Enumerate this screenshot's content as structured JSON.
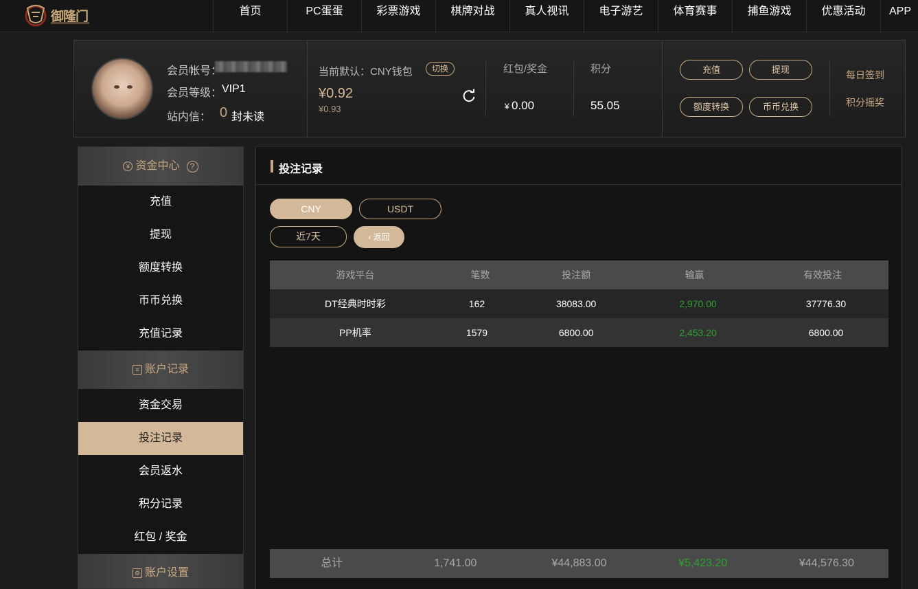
{
  "header": {
    "logo_text": "御隆门",
    "nav": [
      "首页",
      "PC蛋蛋",
      "彩票游戏",
      "棋牌对战",
      "真人视讯",
      "电子游艺",
      "体育赛事",
      "捕鱼游戏",
      "优惠活动",
      "APP"
    ]
  },
  "profile": {
    "account_label": "会员帐号：",
    "level_label": "会员等级：",
    "level_value": "VIP1",
    "inbox_label": "站内信：",
    "inbox_count": "0",
    "inbox_suffix": "封未读",
    "wallet_label": "当前默认：CNY钱包",
    "switch_label": "切换",
    "wallet_amount": "¥0.92",
    "wallet_sub": "¥0.93",
    "bonus_label": "红包/奖金",
    "bonus_currency": "¥",
    "bonus_value": "0.00",
    "points_label": "积分",
    "points_value": "55.05",
    "buttons": {
      "deposit": "充值",
      "withdraw": "提现",
      "transfer": "额度转换",
      "exchange": "币币兑换"
    },
    "daily_signin": "每日签到",
    "points_lottery": "积分摇奖"
  },
  "sidebar": {
    "fund_center": "资金中心",
    "fund_items": [
      "充值",
      "提现",
      "额度转换",
      "币币兑换",
      "充值记录"
    ],
    "account_records": "账户记录",
    "record_items": [
      "资金交易",
      "投注记录",
      "会员返水",
      "积分记录",
      "红包 / 奖金"
    ],
    "account_settings": "账户设置"
  },
  "main": {
    "title": "投注记录",
    "currency_tabs": [
      "CNY",
      "USDT"
    ],
    "period_label": "近7天",
    "back_label": "返回",
    "columns": [
      "游戏平台",
      "笔数",
      "投注额",
      "输赢",
      "有效投注"
    ],
    "rows": [
      [
        "DT经典时时彩",
        "162",
        "38083.00",
        "2,970.00",
        "37776.30"
      ],
      [
        "PP机率",
        "1579",
        "6800.00",
        "2,453.20",
        "6800.00"
      ]
    ],
    "total": [
      "总计",
      "1,741.00",
      "¥44,883.00",
      "¥5,423.20",
      "¥44,576.30"
    ]
  },
  "colors": {
    "accent": "#d4b89a",
    "win": "#2fa02f",
    "background": "#1c1c1c"
  }
}
